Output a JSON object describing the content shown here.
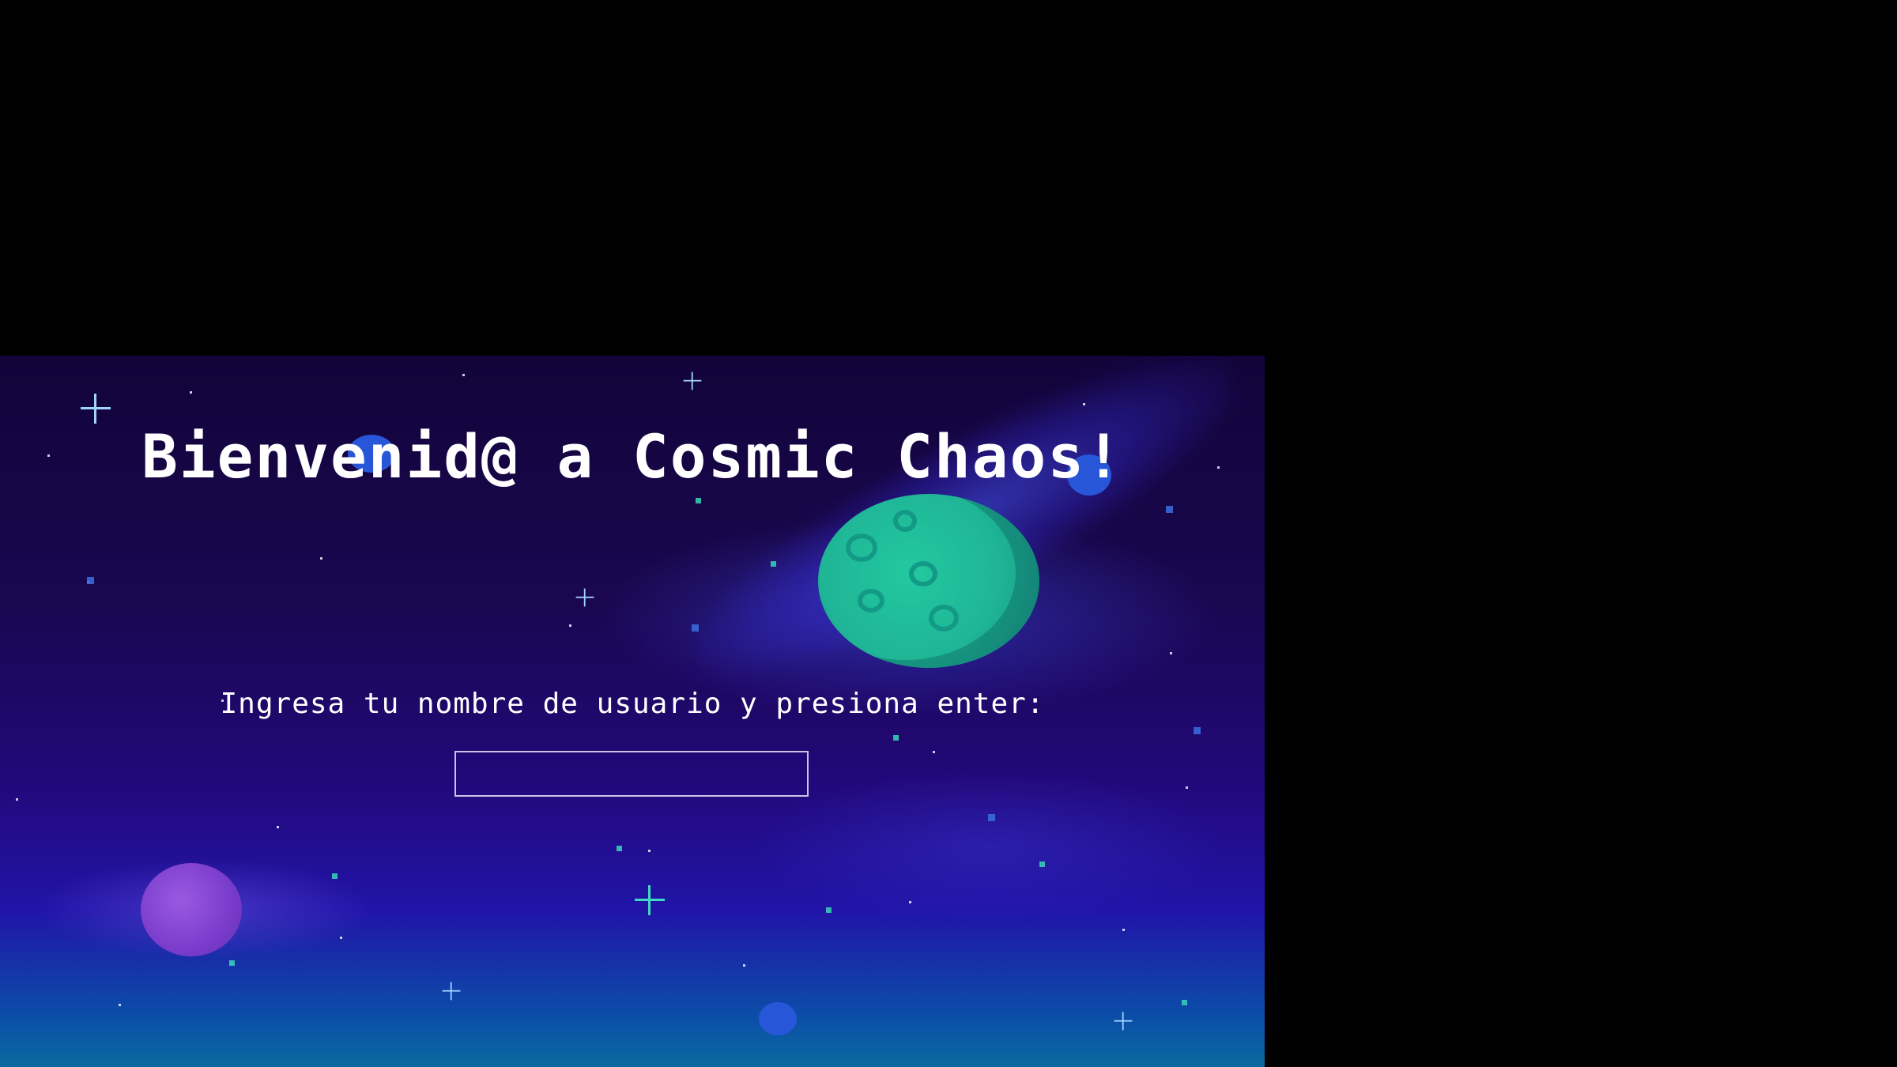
{
  "screen": {
    "title": "Bienvenid@ a Cosmic Chaos!",
    "prompt": "Ingresa tu nombre de usuario y presiona enter:",
    "username_input": {
      "value": "",
      "placeholder": ""
    }
  },
  "colors": {
    "background_outer": "#000000",
    "sky_top": "#12043a",
    "sky_bottom": "#0a6a9e",
    "planet_green": "#1fb596",
    "planet_purple": "#7a3ccc",
    "text": "#ffffff"
  },
  "icons": {
    "planet_main": "green-planet",
    "planet_small": "purple-planet",
    "stars": "sparkle-star"
  }
}
